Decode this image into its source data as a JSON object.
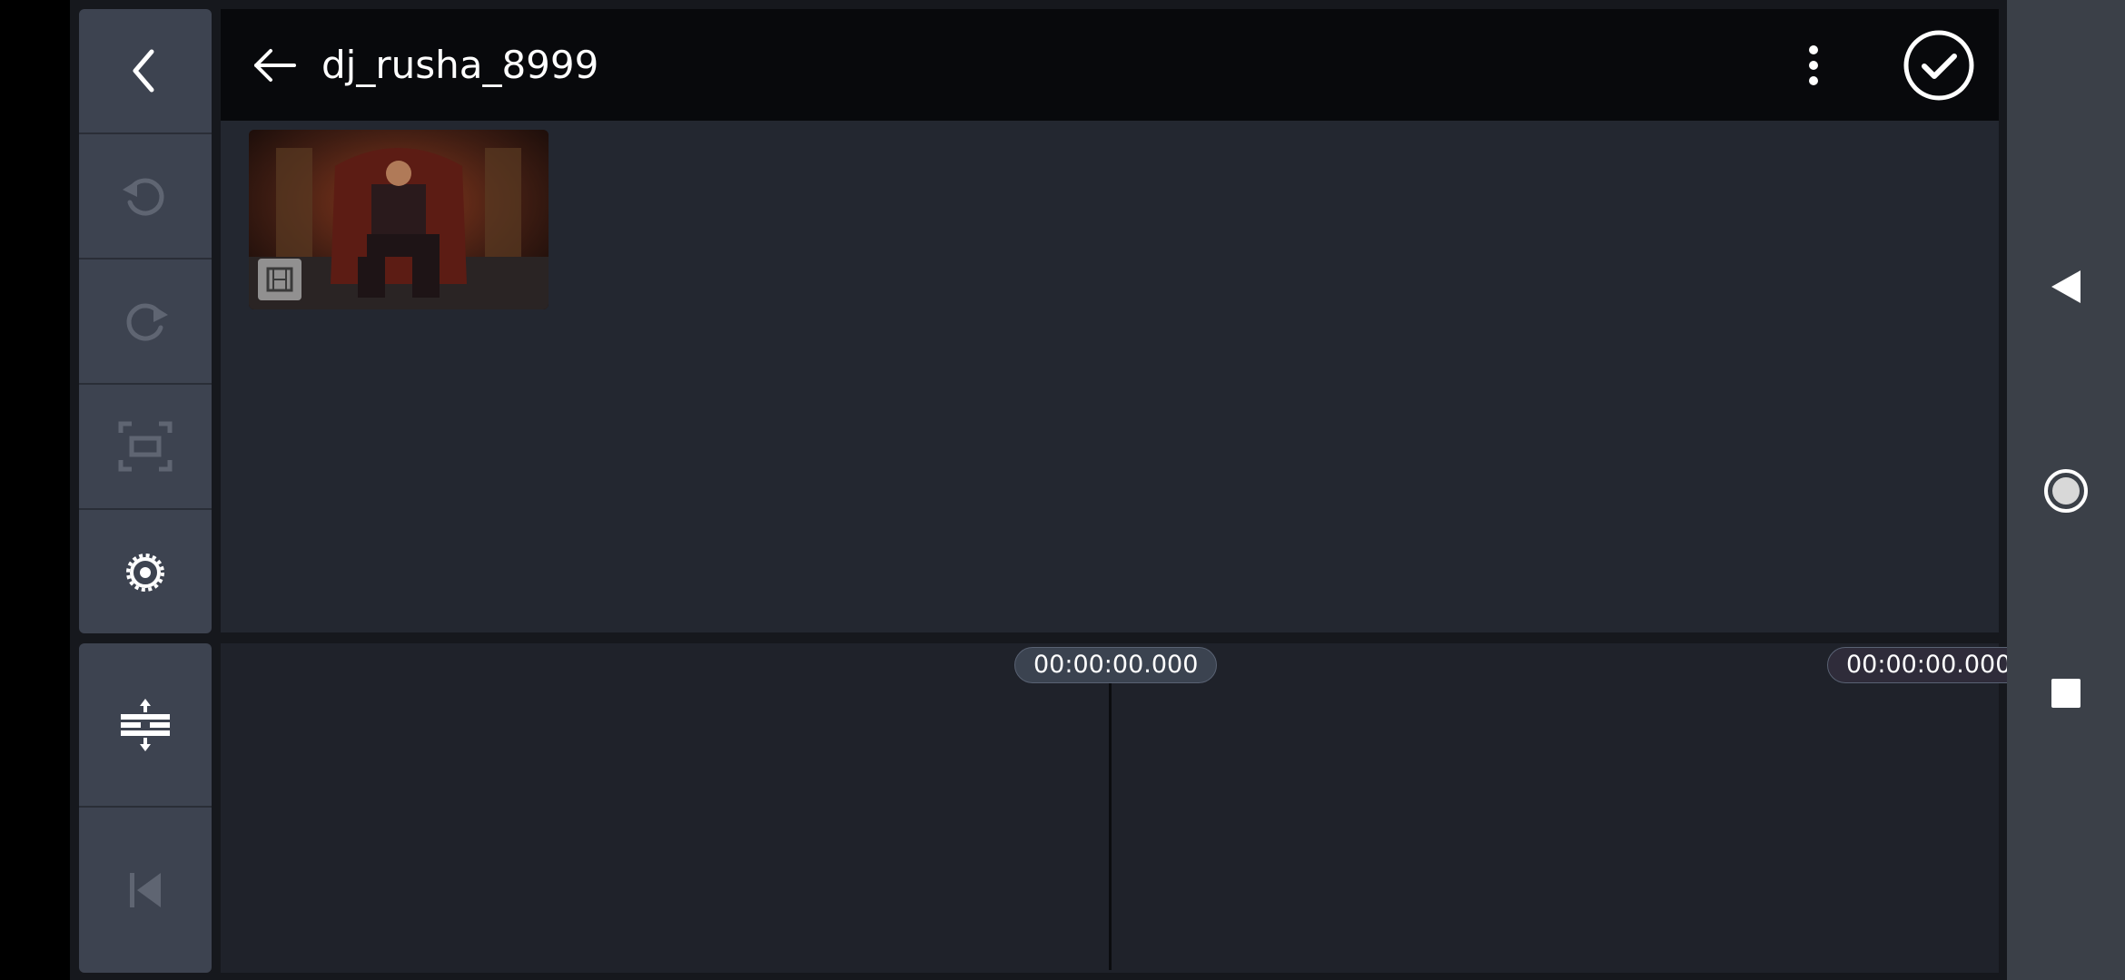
{
  "header": {
    "title": "dj_rusha_8999"
  },
  "timeline": {
    "current_time": "00:00:00.000",
    "total_time": "00:00:00.000"
  },
  "sidebar": {
    "top_buttons": [
      "back-icon",
      "undo-icon",
      "redo-icon",
      "fit-screen-icon",
      "settings-icon"
    ],
    "bottom_buttons": [
      "expand-collapse-icon",
      "skip-to-start-icon"
    ]
  },
  "media_browser": {
    "items": [
      {
        "type": "video",
        "icon": "film-icon"
      }
    ]
  },
  "system_nav": [
    "nav-back-icon",
    "nav-home-icon",
    "nav-recents-icon"
  ],
  "colors": {
    "header_bg": "#08090c",
    "panel_bg": "#232730",
    "sidebar_bg": "#3d4350",
    "timecode_bg": "#3b4350"
  }
}
